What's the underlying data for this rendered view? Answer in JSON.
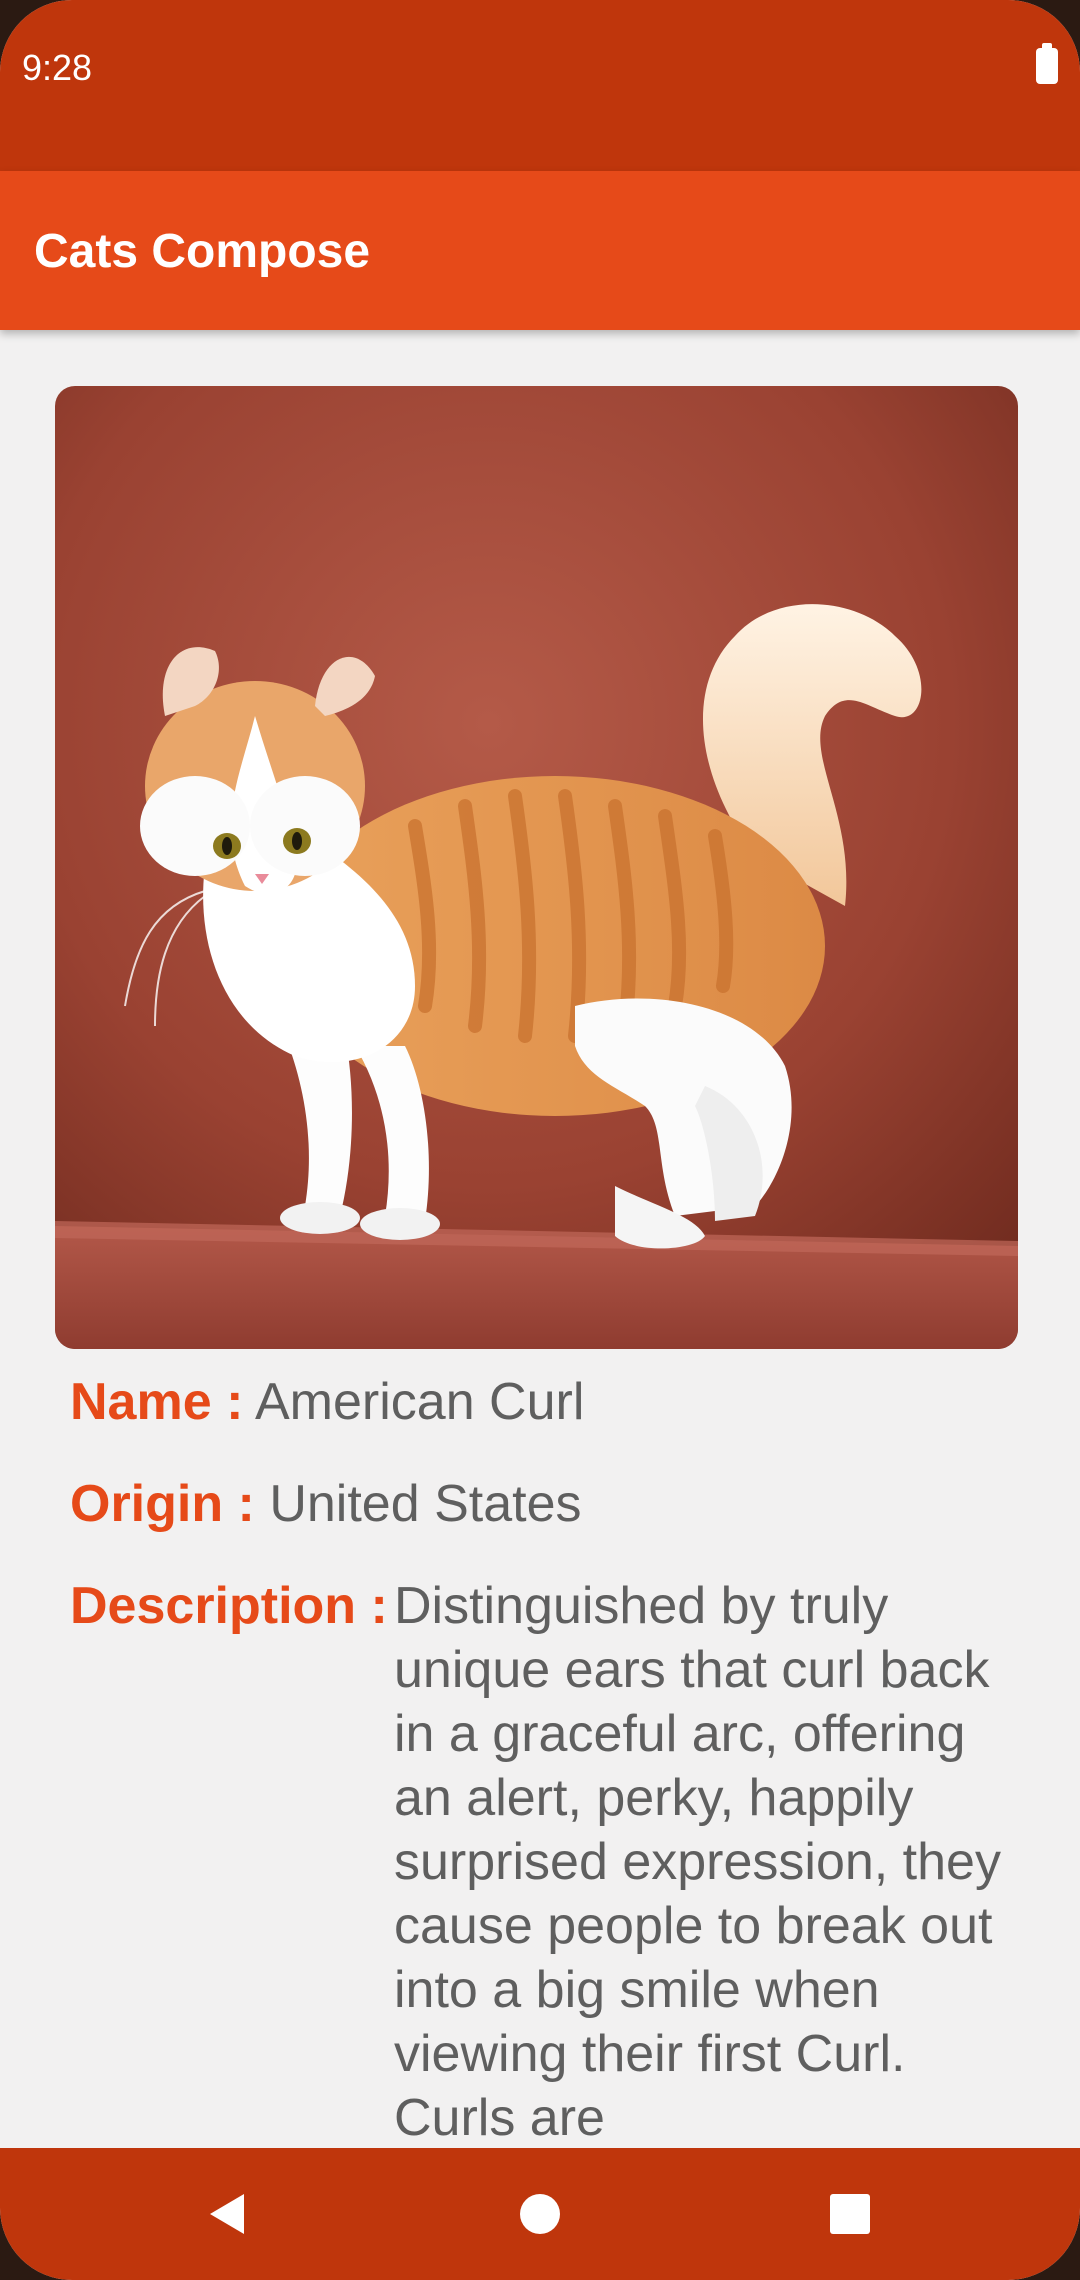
{
  "status_bar": {
    "time": "9:28"
  },
  "app_bar": {
    "title": "Cats Compose"
  },
  "cat": {
    "image_description_icon": "cat-photo",
    "name_label": "Name :",
    "name": "American Curl",
    "origin_label": "Origin :",
    "origin": "United States",
    "description_label": "Description :",
    "description": "Distinguished by truly unique ears that curl back in a graceful arc, offering an alert, perky, happily surprised expression, they cause people to break out into a big smile when viewing their first Curl. Curls are"
  },
  "nav_bar": {
    "back_icon": "back-triangle-icon",
    "home_icon": "home-circle-icon",
    "recents_icon": "recents-square-icon"
  },
  "colors": {
    "status_bar": "#bf360c",
    "app_bar": "#e64a19",
    "label_accent": "#e64a19",
    "value_text": "#5f5f5f",
    "background": "#f2f1f1"
  }
}
